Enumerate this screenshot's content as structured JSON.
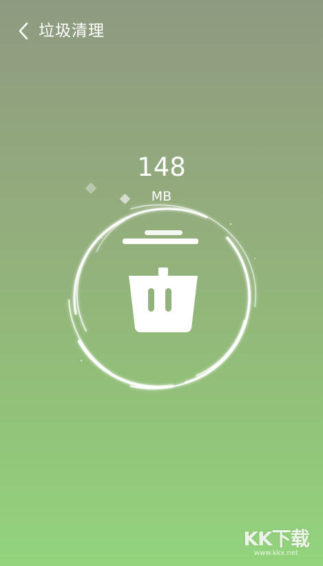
{
  "header": {
    "title": "垃圾清理",
    "back_icon": "chevron-left-icon"
  },
  "scan": {
    "size_value": "148",
    "size_unit": "MB"
  },
  "graphics": {
    "center_icon": "trash-icon",
    "ring_effect": "swirl-ring"
  },
  "watermark": {
    "logo_text": "KK下载",
    "url_text": "www.kkx.net"
  },
  "colors": {
    "background_top": "#8e9a80",
    "background_bottom": "#93d47c",
    "foreground": "#ffffff"
  }
}
